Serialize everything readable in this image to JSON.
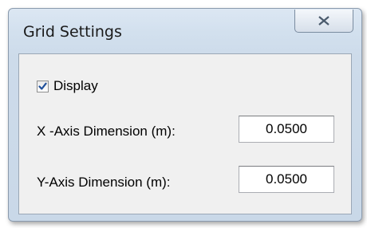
{
  "dialog": {
    "title": "Grid Settings",
    "close_icon": "close-icon"
  },
  "display": {
    "label": "Display",
    "checked": true,
    "icon": "checkmark-icon"
  },
  "fields": {
    "x_label": "X -Axis Dimension (m):",
    "x_value": "0.0500",
    "y_label": "Y-Axis Dimension (m):",
    "y_value": "0.0500"
  },
  "colors": {
    "title_bar": "#d2e0ee",
    "client_bg": "#f0f0f0",
    "check_mark": "#1f4f9a"
  }
}
